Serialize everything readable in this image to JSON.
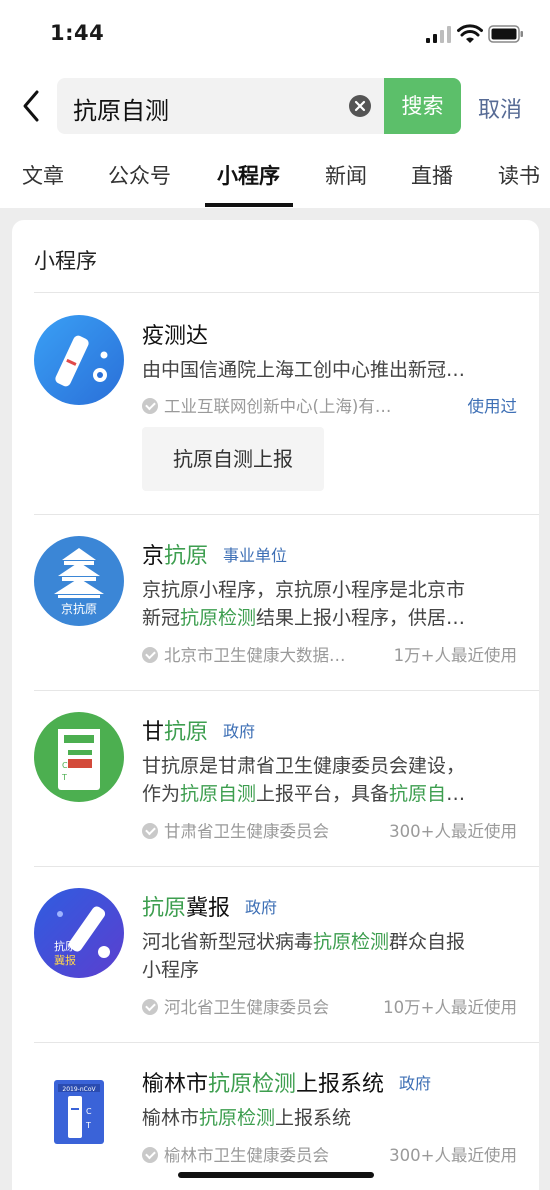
{
  "status": {
    "time": "1:44"
  },
  "search": {
    "query": "抗原自测",
    "button": "搜索",
    "cancel": "取消"
  },
  "tabs": [
    {
      "label": "文章"
    },
    {
      "label": "公众号"
    },
    {
      "label": "小程序",
      "active": true
    },
    {
      "label": "新闻"
    },
    {
      "label": "直播"
    },
    {
      "label": "读书"
    }
  ],
  "section": {
    "title": "小程序"
  },
  "results": [
    {
      "name": {
        "pre": "疫测达",
        "hl": "",
        "post": ""
      },
      "badge": "",
      "desc": [
        [
          {
            "t": "由中国信通院上海工创中心推出新冠…",
            "h": false
          }
        ]
      ],
      "org": "工业互联网创新中心(上海)有…",
      "usage": "使用过",
      "action": "抗原自测上报"
    },
    {
      "name": {
        "pre": "京",
        "hl": "抗原",
        "post": ""
      },
      "badge": "事业单位",
      "desc": [
        [
          {
            "t": "京抗原小程序，京抗原小程序是北京市",
            "h": false
          }
        ],
        [
          {
            "t": "新冠",
            "h": false
          },
          {
            "t": "抗原检测",
            "h": true
          },
          {
            "t": "结果上报小程序，供居…",
            "h": false
          }
        ]
      ],
      "org": "北京市卫生健康大数据…",
      "usage": "1万+人最近使用",
      "logo_text": "京抗原"
    },
    {
      "name": {
        "pre": "甘",
        "hl": "抗原",
        "post": ""
      },
      "badge": "政府",
      "desc": [
        [
          {
            "t": "甘抗原是甘肃省卫生健康委员会建设，",
            "h": false
          }
        ],
        [
          {
            "t": "作为",
            "h": false
          },
          {
            "t": "抗原自测",
            "h": true
          },
          {
            "t": "上报平台，具备",
            "h": false
          },
          {
            "t": "抗原自",
            "h": true
          },
          {
            "t": "…",
            "h": false
          }
        ]
      ],
      "org": "甘肃省卫生健康委员会",
      "usage": "300+人最近使用"
    },
    {
      "name": {
        "pre": "",
        "hl": "抗原",
        "post": "冀报"
      },
      "badge": "政府",
      "desc": [
        [
          {
            "t": "河北省新型冠状病毒",
            "h": false
          },
          {
            "t": "抗原检测",
            "h": true
          },
          {
            "t": "群众自报",
            "h": false
          }
        ],
        [
          {
            "t": "小程序",
            "h": false
          }
        ]
      ],
      "org": "河北省卫生健康委员会",
      "usage": "10万+人最近使用",
      "logo_text": "抗原\n冀报"
    },
    {
      "name": {
        "pre": "榆林市",
        "hl": "抗原检测",
        "post": "上报系统"
      },
      "badge": "政府",
      "desc": [
        [
          {
            "t": "榆林市",
            "h": false
          },
          {
            "t": "抗原检测",
            "h": true
          },
          {
            "t": "上报系统",
            "h": false
          }
        ]
      ],
      "org": "榆林市卫生健康委员会",
      "usage": "300+人最近使用",
      "logo_text": "2019-nCoV"
    }
  ],
  "colors": {
    "accent_green": "#5cbf6a",
    "highlight_green": "#3d9e4f",
    "link_blue": "#3d6fb5",
    "cancel_blue": "#576b95"
  }
}
